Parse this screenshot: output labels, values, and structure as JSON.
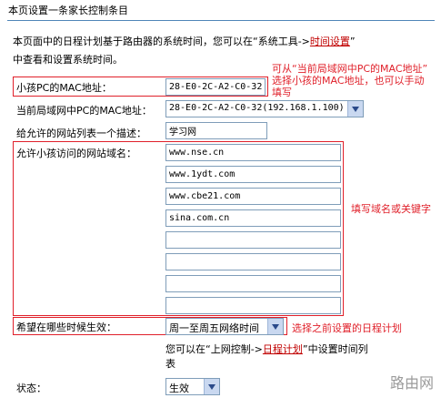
{
  "page": {
    "title": "本页设置一条家长控制条目",
    "desc_part1": "本页面中的日程计划基于路由器的系统时间，您可以在“系统工具->",
    "desc_link": "时间设置",
    "desc_part2": "”",
    "desc_line2": "中查看和设置系统时间。"
  },
  "form": {
    "child_mac_label": "小孩PC的MAC地址：",
    "child_mac_value": "28-E0-2C-A2-C0-32",
    "lan_mac_label": "当前局域网中PC的MAC地址：",
    "lan_mac_selected": "28-E0-2C-A2-C0-32(192.168.1.100)",
    "list_desc_label": "给允许的网站列表一个描述：",
    "list_desc_value": "学习网",
    "allowed_label": "允许小孩访问的网站域名：",
    "domains": [
      "www.nse.cn",
      "www.1ydt.com",
      "www.cbe21.com",
      "sina.com.cn",
      "",
      "",
      "",
      ""
    ],
    "schedule_label": "希望在哪些时候生效：",
    "schedule_selected": "周一至周五网络时间",
    "schedule_hint_part1": "您可以在“上网控制->",
    "schedule_hint_link": "日程计划",
    "schedule_hint_part2": "”中设置时间列",
    "schedule_hint_line2": "表",
    "status_label": "状态：",
    "status_selected": "生效"
  },
  "annotations": {
    "mac_note_line1": "可从“当前局域网中PC的MAC地址”",
    "mac_note_line2": "选择小孩的MAC地址，也可以手动",
    "mac_note_line3": "填写",
    "domain_note": "填写域名或关键字",
    "schedule_note": "选择之前设置的日程计划"
  },
  "watermark": "路由网",
  "colors": {
    "annotation_red": "#e0202a",
    "link_red": "#c00000",
    "divider_blue": "#4f86b8"
  }
}
